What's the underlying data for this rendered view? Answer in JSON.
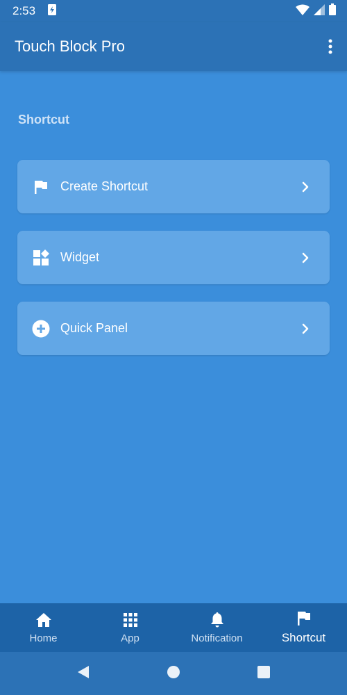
{
  "status_bar": {
    "time": "2:53"
  },
  "app_bar": {
    "title": "Touch Block Pro"
  },
  "section": {
    "title": "Shortcut"
  },
  "menu": {
    "items": [
      {
        "label": "Create Shortcut",
        "icon": "flag-icon"
      },
      {
        "label": "Widget",
        "icon": "widgets-icon"
      },
      {
        "label": "Quick Panel",
        "icon": "add-circle-icon"
      }
    ]
  },
  "bottom_nav": {
    "items": [
      {
        "label": "Home",
        "icon": "home-icon"
      },
      {
        "label": "App",
        "icon": "apps-grid-icon"
      },
      {
        "label": "Notification",
        "icon": "bell-icon"
      },
      {
        "label": "Shortcut",
        "icon": "flag-icon"
      }
    ],
    "active": "Shortcut"
  },
  "colors": {
    "background": "#3b8edb",
    "app_bar": "#2c72b6",
    "card": "#62a7e6",
    "bottom_nav": "#1d63a7",
    "section_title": "#cfe3f7"
  }
}
